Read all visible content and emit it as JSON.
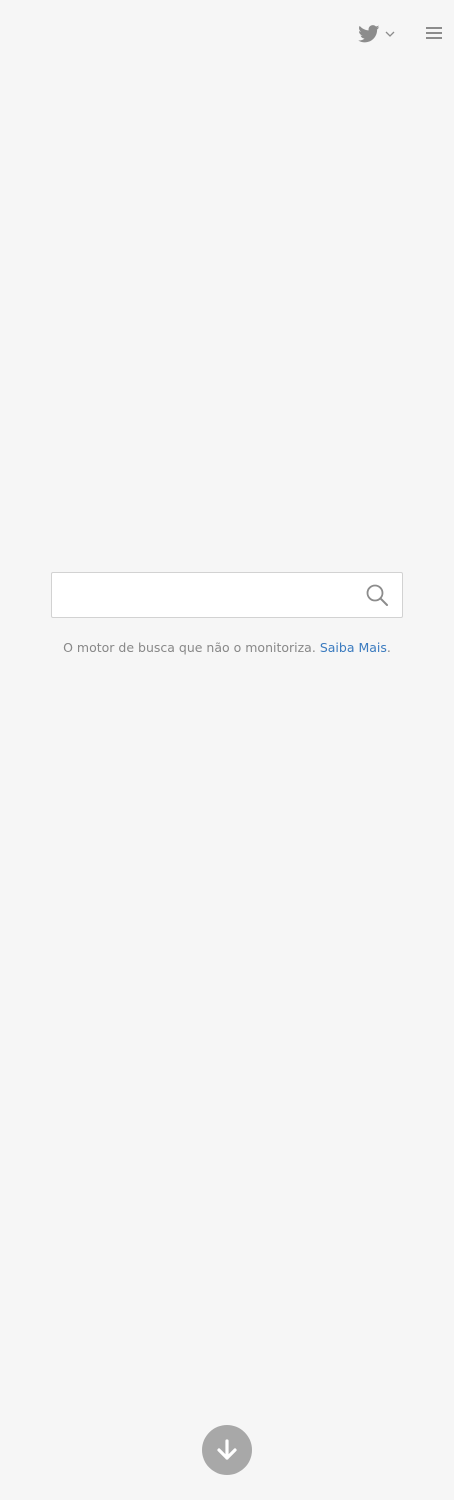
{
  "header": {
    "twitter_icon": "twitter-bird-icon",
    "dropdown_icon": "chevron-down-icon",
    "menu_icon": "hamburger-menu-icon"
  },
  "search": {
    "value": "",
    "placeholder": "",
    "button_icon": "search-icon"
  },
  "tagline": {
    "text": "O motor de busca que não o monitoriza.",
    "link_label": "Saiba Mais",
    "suffix": "."
  },
  "footer": {
    "scroll_icon": "arrow-down-icon"
  },
  "colors": {
    "background": "#f6f6f6",
    "icon_gray": "#8c8c8c",
    "link_blue": "#3b7bbf",
    "text_gray": "#888888",
    "scroll_button": "#a8a8a8"
  }
}
